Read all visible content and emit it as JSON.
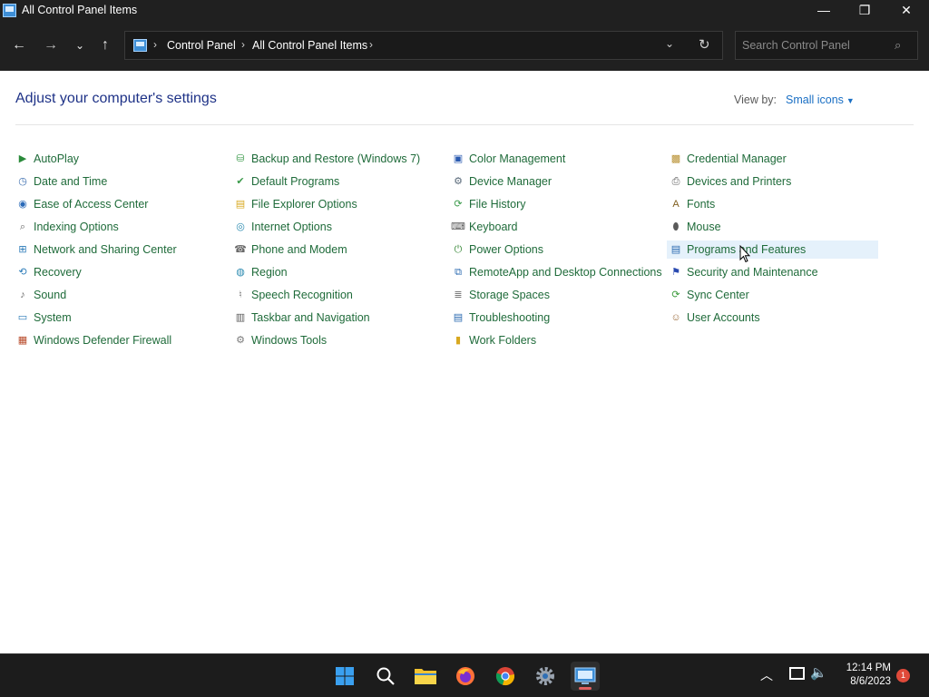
{
  "window": {
    "title": "All Control Panel Items",
    "minimize_glyph": "—",
    "maximize_glyph": "❐",
    "close_glyph": "✕"
  },
  "nav": {
    "back_glyph": "←",
    "forward_glyph": "→",
    "recent_glyph": "⌄",
    "up_glyph": "↑",
    "breadcrumb": [
      "Control Panel",
      "All Control Panel Items"
    ],
    "search_placeholder": "Search Control Panel"
  },
  "content": {
    "heading": "Adjust your computer's settings",
    "view_by_label": "View by:",
    "view_by_value": "Small icons",
    "columns": [
      [
        {
          "label": "AutoPlay",
          "icon": "autoplay-icon"
        },
        {
          "label": "Date and Time",
          "icon": "clock-icon"
        },
        {
          "label": "Ease of Access Center",
          "icon": "accessibility-icon"
        },
        {
          "label": "Indexing Options",
          "icon": "magnifier-icon"
        },
        {
          "label": "Network and Sharing Center",
          "icon": "network-icon"
        },
        {
          "label": "Recovery",
          "icon": "recovery-icon"
        },
        {
          "label": "Sound",
          "icon": "speaker-icon"
        },
        {
          "label": "System",
          "icon": "computer-icon"
        },
        {
          "label": "Windows Defender Firewall",
          "icon": "firewall-icon"
        }
      ],
      [
        {
          "label": "Backup and Restore (Windows 7)",
          "icon": "backup-icon"
        },
        {
          "label": "Default Programs",
          "icon": "default-programs-icon"
        },
        {
          "label": "File Explorer Options",
          "icon": "folder-options-icon"
        },
        {
          "label": "Internet Options",
          "icon": "globe-icon"
        },
        {
          "label": "Phone and Modem",
          "icon": "phone-icon"
        },
        {
          "label": "Region",
          "icon": "region-globe-icon"
        },
        {
          "label": "Speech Recognition",
          "icon": "microphone-icon"
        },
        {
          "label": "Taskbar and Navigation",
          "icon": "taskbar-icon"
        },
        {
          "label": "Windows Tools",
          "icon": "tools-icon"
        }
      ],
      [
        {
          "label": "Color Management",
          "icon": "color-monitor-icon"
        },
        {
          "label": "Device Manager",
          "icon": "device-manager-icon"
        },
        {
          "label": "File History",
          "icon": "file-history-icon"
        },
        {
          "label": "Keyboard",
          "icon": "keyboard-icon"
        },
        {
          "label": "Power Options",
          "icon": "power-icon"
        },
        {
          "label": "RemoteApp and Desktop Connections",
          "icon": "remote-desktop-icon"
        },
        {
          "label": "Storage Spaces",
          "icon": "storage-icon"
        },
        {
          "label": "Troubleshooting",
          "icon": "troubleshoot-icon"
        },
        {
          "label": "Work Folders",
          "icon": "work-folders-icon"
        }
      ],
      [
        {
          "label": "Credential Manager",
          "icon": "credential-vault-icon"
        },
        {
          "label": "Devices and Printers",
          "icon": "printer-icon"
        },
        {
          "label": "Fonts",
          "icon": "font-icon"
        },
        {
          "label": "Mouse",
          "icon": "mouse-icon"
        },
        {
          "label": "Programs and Features",
          "icon": "programs-icon",
          "hover": true
        },
        {
          "label": "Security and Maintenance",
          "icon": "flag-icon"
        },
        {
          "label": "Sync Center",
          "icon": "sync-icon"
        },
        {
          "label": "User Accounts",
          "icon": "users-icon"
        }
      ]
    ]
  },
  "taskbar": {
    "apps": [
      "start-icon",
      "search-icon",
      "file-explorer-icon",
      "firefox-icon",
      "chrome-icon",
      "settings-icon",
      "control-panel-icon"
    ],
    "time": "12:14 PM",
    "date": "8/6/2023",
    "notification_count": "1"
  },
  "colors": {
    "link_green": "#1f6b3a",
    "heading_blue": "#1e3287",
    "accent_blue": "#1a6fc4",
    "hover_bg": "#e5f1fb",
    "chrome_dark": "#202020"
  }
}
